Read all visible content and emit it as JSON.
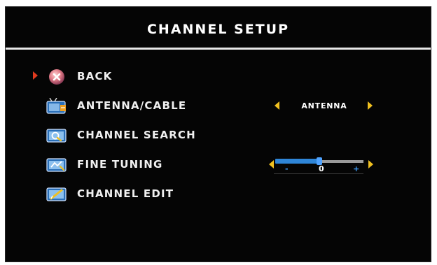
{
  "title": "CHANNEL SETUP",
  "colors": {
    "background": "#050505",
    "text": "#f0f0f0",
    "cursor": "#e03a1e",
    "arrows": "#f0c020",
    "slider_fill": "#2f86d8"
  },
  "menu": {
    "items": [
      {
        "label": "BACK",
        "icon": "back-icon",
        "selected": true
      },
      {
        "label": "ANTENNA/CABLE",
        "icon": "antenna-cable-icon",
        "value": "ANTENNA"
      },
      {
        "label": "CHANNEL SEARCH",
        "icon": "channel-search-icon"
      },
      {
        "label": "FINE TUNING",
        "icon": "fine-tuning-icon",
        "slider": {
          "minus": "-",
          "value": "0",
          "plus": "+",
          "level": 0.5
        }
      },
      {
        "label": "CHANNEL EDIT",
        "icon": "channel-edit-icon"
      }
    ]
  }
}
